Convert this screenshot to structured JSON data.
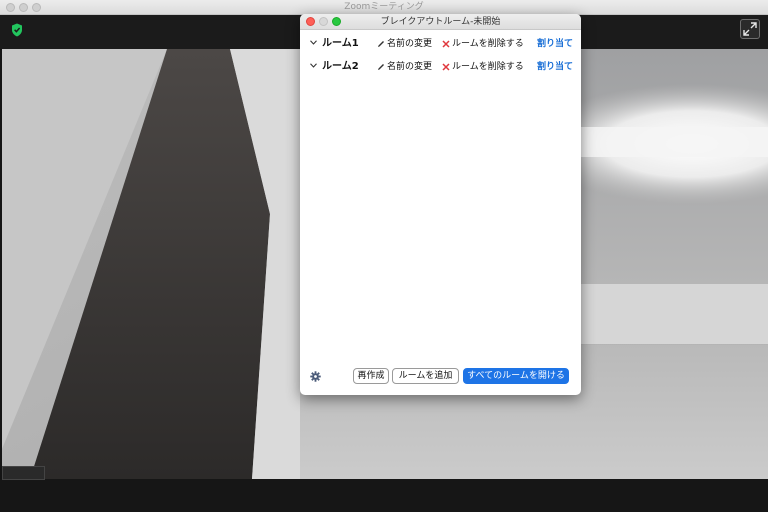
{
  "window": {
    "title": "Zoomミーティング"
  },
  "dialog": {
    "title": "ブレイクアウトルーム-未開始",
    "rooms": [
      {
        "name": "ルーム1",
        "rename_label": "名前の変更",
        "delete_label": "ルームを削除する",
        "assign_label": "割り当て"
      },
      {
        "name": "ルーム2",
        "rename_label": "名前の変更",
        "delete_label": "ルームを削除する",
        "assign_label": "割り当て"
      }
    ],
    "footer": {
      "recreate_label": "再作成",
      "add_room_label": "ルームを追加",
      "open_all_label": "すべてのルームを開ける"
    }
  },
  "icons": {
    "security": "shield-icon",
    "fullscreen": "expand-icon",
    "settings": "gear-icon",
    "rename": "pencil-icon",
    "delete": "x-icon",
    "expand_room": "chevron-down-icon"
  },
  "colors": {
    "accent": "#1e74e6",
    "assign_link": "#1a6fd6",
    "delete_x": "#e0383e",
    "shield": "#22c55e",
    "close_light": "#fe5f57",
    "minimize_light": "#d8d8d8",
    "zoom_light": "#28c840"
  }
}
